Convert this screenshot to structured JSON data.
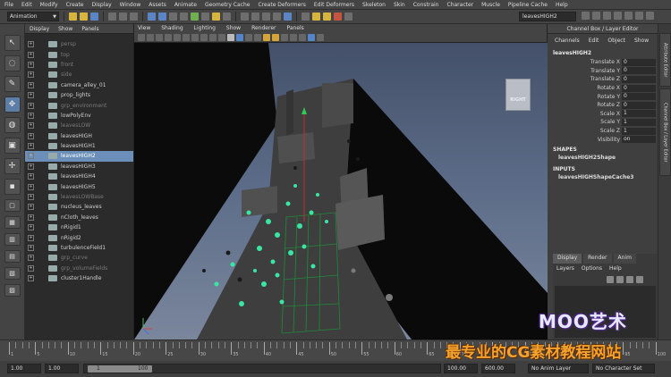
{
  "menubar": [
    "File",
    "Edit",
    "Modify",
    "Create",
    "Display",
    "Window",
    "Assets",
    "Animate",
    "Geometry Cache",
    "Create Deformers",
    "Edit Deformers",
    "Skeleton",
    "Skin",
    "Constrain",
    "Character",
    "Muscle",
    "Pipeline Cache",
    "Help"
  ],
  "status": {
    "mode": "Animation",
    "selection_field": "leavesHIGH2"
  },
  "outliner": {
    "menu": [
      "Display",
      "Show",
      "Panels"
    ],
    "items": [
      {
        "label": "persp",
        "dim": true,
        "sel": false
      },
      {
        "label": "top",
        "dim": true,
        "sel": false
      },
      {
        "label": "front",
        "dim": true,
        "sel": false
      },
      {
        "label": "side",
        "dim": true,
        "sel": false
      },
      {
        "label": "camera_alley_01",
        "dim": false,
        "sel": false
      },
      {
        "label": "prop_lights",
        "dim": false,
        "sel": false
      },
      {
        "label": "grp_environment",
        "dim": true,
        "sel": false
      },
      {
        "label": "lowPolyEnv",
        "dim": false,
        "sel": false
      },
      {
        "label": "leavesLOW",
        "dim": true,
        "sel": false
      },
      {
        "label": "leavesHIGH",
        "dim": false,
        "sel": false
      },
      {
        "label": "leavesHIGH1",
        "dim": false,
        "sel": false
      },
      {
        "label": "leavesHIGH2",
        "dim": false,
        "sel": true
      },
      {
        "label": "leavesHIGH3",
        "dim": false,
        "sel": false
      },
      {
        "label": "leavesHIGH4",
        "dim": false,
        "sel": false
      },
      {
        "label": "leavesHIGH5",
        "dim": false,
        "sel": false
      },
      {
        "label": "leavesLOWBase",
        "dim": true,
        "sel": false
      },
      {
        "label": "nucleus_leaves",
        "dim": false,
        "sel": false
      },
      {
        "label": "nCloth_leaves",
        "dim": false,
        "sel": false
      },
      {
        "label": "nRigid1",
        "dim": false,
        "sel": false
      },
      {
        "label": "nRigid2",
        "dim": false,
        "sel": false
      },
      {
        "label": "turbulenceField1",
        "dim": false,
        "sel": false
      },
      {
        "label": "grp_curve",
        "dim": true,
        "sel": false
      },
      {
        "label": "grp_volumeFields",
        "dim": true,
        "sel": false
      },
      {
        "label": "cluster1Handle",
        "dim": false,
        "sel": false
      }
    ]
  },
  "viewport": {
    "menu": [
      "View",
      "Shading",
      "Lighting",
      "Show",
      "Renderer",
      "Panels"
    ],
    "viewcube_label": "RIGHT",
    "camera_label": "persp"
  },
  "channel_box": {
    "title": "Channel Box / Layer Editor",
    "menu": [
      "Channels",
      "Edit",
      "Object",
      "Show"
    ],
    "object": "leavesHIGH2",
    "attributes": [
      {
        "label": "Translate X",
        "value": "0"
      },
      {
        "label": "Translate Y",
        "value": "0"
      },
      {
        "label": "Translate Z",
        "value": "0"
      },
      {
        "label": "Rotate X",
        "value": "0"
      },
      {
        "label": "Rotate Y",
        "value": "0"
      },
      {
        "label": "Rotate Z",
        "value": "0"
      },
      {
        "label": "Scale X",
        "value": "1"
      },
      {
        "label": "Scale Y",
        "value": "1"
      },
      {
        "label": "Scale Z",
        "value": "1"
      },
      {
        "label": "Visibility",
        "value": "on"
      }
    ],
    "shapes_head": "SHAPES",
    "shape": "leavesHIGH2Shape",
    "inputs_head": "INPUTS",
    "input": "leavesHIGHShapeCache3"
  },
  "layer_editor": {
    "tabs": [
      "Display",
      "Render",
      "Anim"
    ],
    "menu": [
      "Layers",
      "Options",
      "Help"
    ]
  },
  "side_tabs": [
    "Attribute Editor",
    "Channel Box / Layer Editor"
  ],
  "timeline": {
    "labels": [
      "1",
      "5",
      "10",
      "15",
      "20",
      "25",
      "30",
      "35",
      "40",
      "45",
      "50",
      "55",
      "60",
      "65",
      "70",
      "75",
      "80",
      "85",
      "90",
      "95",
      "100"
    ]
  },
  "range": {
    "start": "1.00",
    "start2": "1.00",
    "slider_a": "1",
    "slider_b": "100",
    "end": "100.00",
    "end2": "600.00",
    "anim_layer": "No Anim Layer",
    "char_set": "No Character Set"
  },
  "watermark": {
    "brand": "MOO艺术",
    "tagline": "最专业的CG素材教程网站"
  }
}
